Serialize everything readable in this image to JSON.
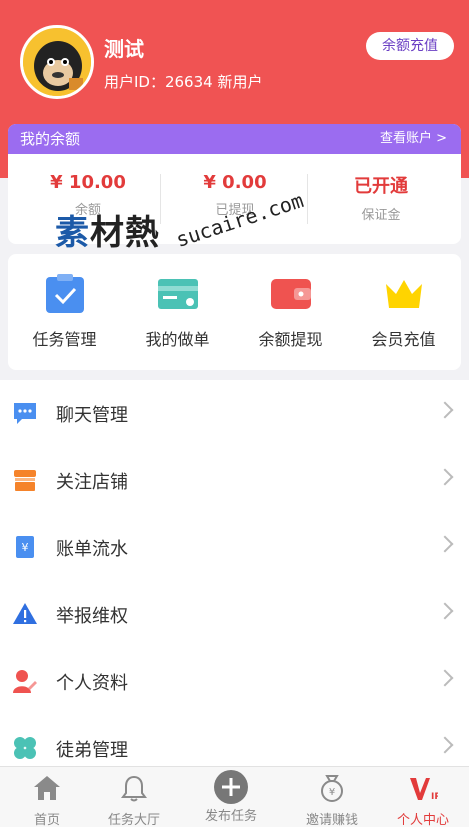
{
  "profile": {
    "name": "测试",
    "user_id": "用户ID：26634 新用户",
    "topup_button": "余额充值"
  },
  "balance": {
    "title": "我的余额",
    "view_account": "查看账户 >",
    "stats": [
      {
        "value": "¥ 10.00",
        "label": "余额"
      },
      {
        "value": "¥ 0.00",
        "label": "已提现"
      },
      {
        "value": "已开通",
        "label": "保证金"
      }
    ]
  },
  "watermark": {
    "cn_first": "素",
    "cn_rest": "材熱",
    "en": "sucaire.com"
  },
  "quick_actions": [
    {
      "label": "任务管理",
      "icon": "clipboard-check-icon",
      "color": "#4a8ff0"
    },
    {
      "label": "我的做单",
      "icon": "card-icon",
      "color": "#4bc2b5"
    },
    {
      "label": "余额提现",
      "icon": "wallet-icon",
      "color": "#ef5350"
    },
    {
      "label": "会员充值",
      "icon": "crown-icon",
      "color": "#ffd400"
    }
  ],
  "menu": [
    {
      "label": "聊天管理",
      "icon": "chat-icon",
      "color": "#4a8ff0"
    },
    {
      "label": "关注店铺",
      "icon": "store-icon",
      "color": "#f5832a"
    },
    {
      "label": "账单流水",
      "icon": "bill-icon",
      "color": "#4a8ff0"
    },
    {
      "label": "举报维权",
      "icon": "warning-icon",
      "color": "#2f6fe0"
    },
    {
      "label": "个人资料",
      "icon": "profile-edit-icon",
      "color": "#ef5350"
    },
    {
      "label": "徒弟管理",
      "icon": "clover-icon",
      "color": "#4bc2b5"
    }
  ],
  "tabbar": [
    {
      "label": "首页",
      "icon": "home-icon"
    },
    {
      "label": "任务大厅",
      "icon": "bell-icon"
    },
    {
      "label": "发布任务",
      "icon": "plus-circle-icon"
    },
    {
      "label": "邀请赚钱",
      "icon": "money-bag-icon"
    },
    {
      "label": "个人中心",
      "icon": "vip-icon",
      "active": true
    }
  ],
  "colors": {
    "header": "#f05353",
    "balance_header": "#9b6cf0",
    "accent_red": "#e23b3b"
  }
}
